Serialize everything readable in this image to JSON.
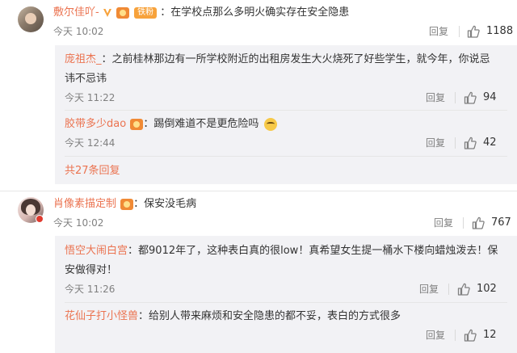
{
  "comments": [
    {
      "username": "敷尔佳吖-",
      "badges": [
        "vip-v-icon",
        "fan-level-icon"
      ],
      "fan_badge": "铁粉",
      "text": "在学校点那么多明火确实存在安全隐患",
      "time": "今天 10:02",
      "reply_label": "回复",
      "likes": "1188",
      "replies": [
        {
          "username": "庞祖杰_",
          "text_line1": "之前桂林那边有一所学校附近的出租房发生大火烧死了好些学生，就今年，你说忌",
          "text_line2": "讳不忌讳",
          "time": "今天 11:22",
          "reply_label": "回复",
          "likes": "94"
        },
        {
          "username": "胶带多少dao",
          "text": "踢倒难道不是更危险吗",
          "time": "今天 12:44",
          "reply_label": "回复",
          "likes": "42"
        }
      ],
      "view_more": "共27条回复"
    },
    {
      "username": "肖像素描定制",
      "text": "保安没毛病",
      "time": "今天 10:02",
      "reply_label": "回复",
      "likes": "767",
      "replies": [
        {
          "username": "悟空大闹白宫",
          "text_line1": "都9012年了，这种表白真的很low！真希望女生提一桶水下楼向蜡烛泼去！保",
          "text_line2": "安做得对！",
          "time": "今天 11:26",
          "reply_label": "回复",
          "likes": "102"
        },
        {
          "username": "花仙子打小怪兽",
          "text": "给别人带来麻烦和安全隐患的都不妥，表白的方式很多",
          "reply_label": "回复",
          "likes": "12"
        }
      ]
    }
  ],
  "colors": {
    "username": "#eb7350",
    "meta": "#808080",
    "sub_background": "#f2f2f5"
  }
}
